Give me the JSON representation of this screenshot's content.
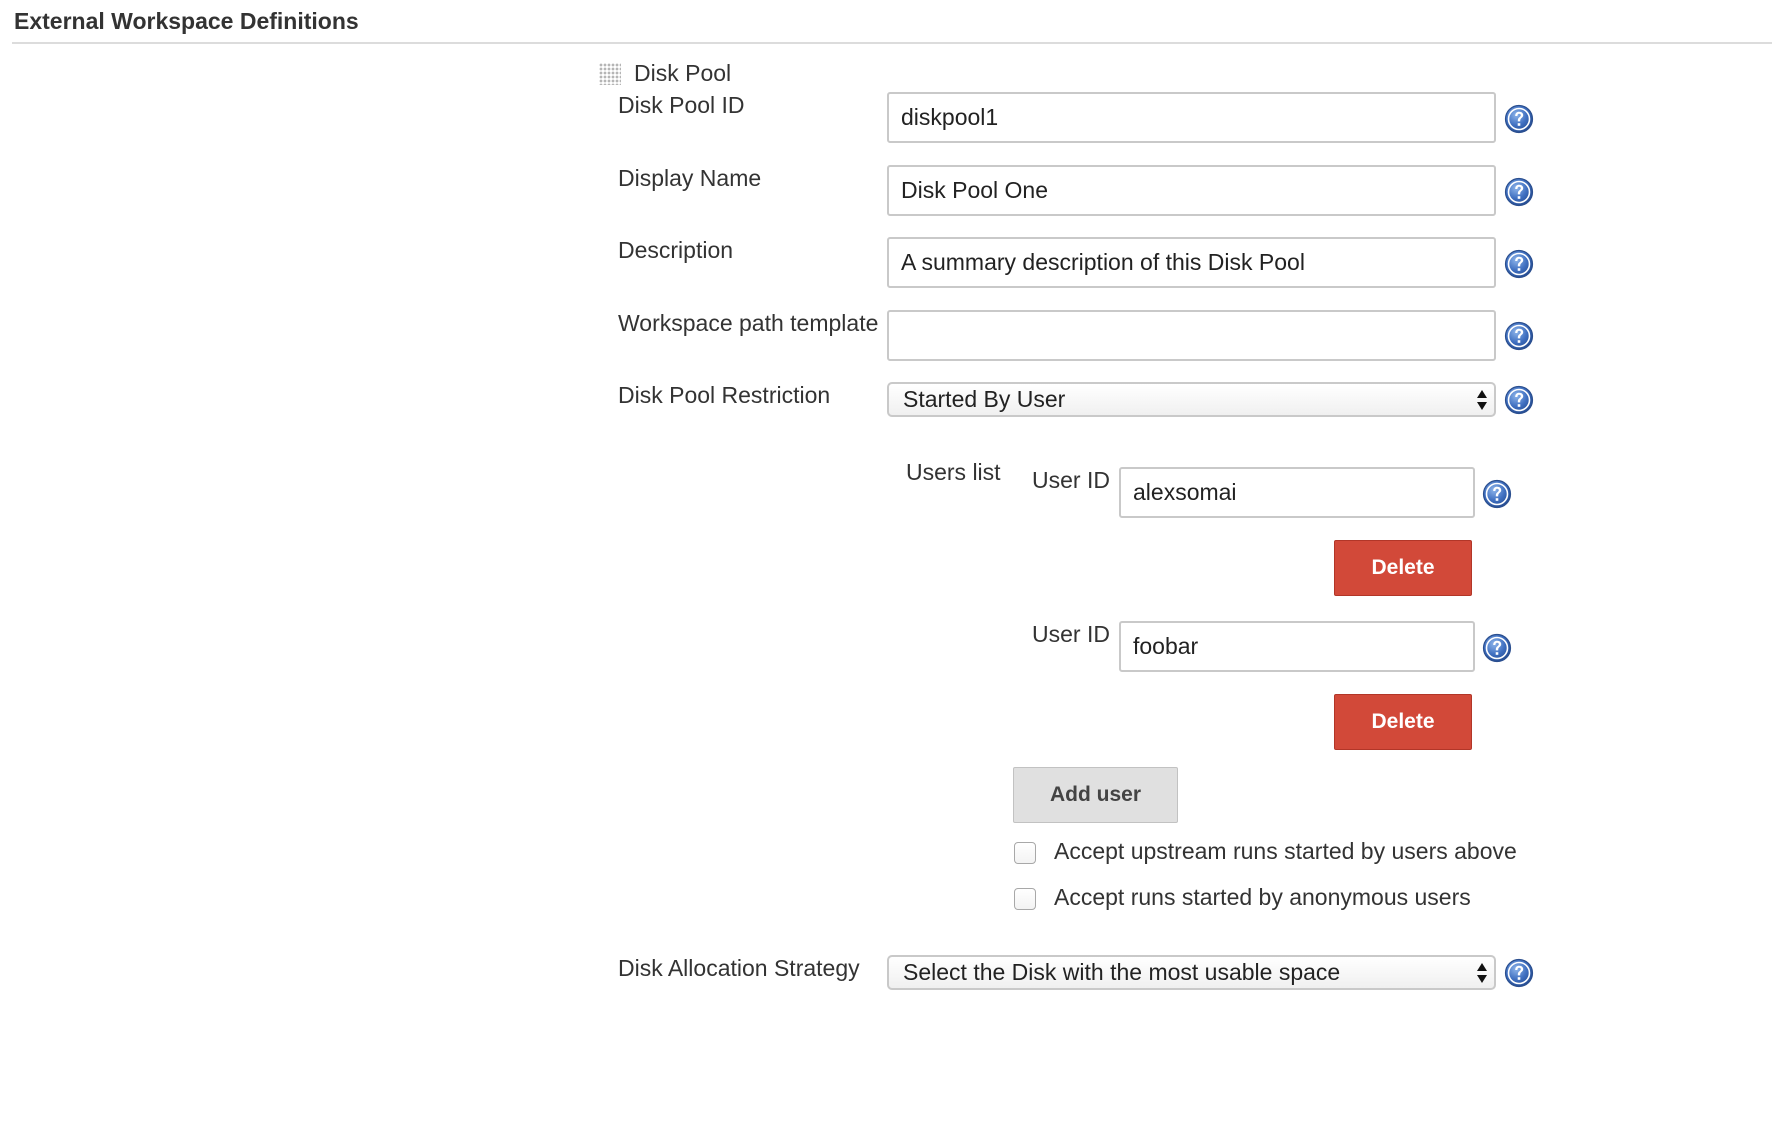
{
  "section": {
    "title": "External Workspace Definitions"
  },
  "disk_pool": {
    "header": "Disk Pool",
    "fields": {
      "disk_pool_id": {
        "label": "Disk Pool ID",
        "value": "diskpool1"
      },
      "display_name": {
        "label": "Display Name",
        "value": "Disk Pool One"
      },
      "description": {
        "label": "Description",
        "value": "A summary description of this Disk Pool"
      },
      "workspace_path_template": {
        "label": "Workspace path template",
        "value": ""
      },
      "disk_pool_restriction": {
        "label": "Disk Pool Restriction",
        "selected": "Started By User"
      }
    },
    "users_list": {
      "label": "Users list",
      "users": [
        {
          "label": "User ID",
          "value": "alexsomai",
          "delete_label": "Delete"
        },
        {
          "label": "User ID",
          "value": "foobar",
          "delete_label": "Delete"
        }
      ],
      "add_user_label": "Add user",
      "checkboxes": [
        {
          "label": "Accept upstream runs started by users above",
          "checked": false
        },
        {
          "label": "Accept runs started by anonymous users",
          "checked": false
        }
      ]
    },
    "disk_allocation_strategy": {
      "label": "Disk Allocation Strategy",
      "selected": "Select the Disk with the most usable space"
    }
  },
  "colors": {
    "delete_button": "#d24939",
    "help_icon": "#4a7cc4"
  },
  "icons": {
    "help": "help-icon",
    "drag_handle": "drag-handle-icon",
    "select_arrows": "select-arrows-icon"
  }
}
